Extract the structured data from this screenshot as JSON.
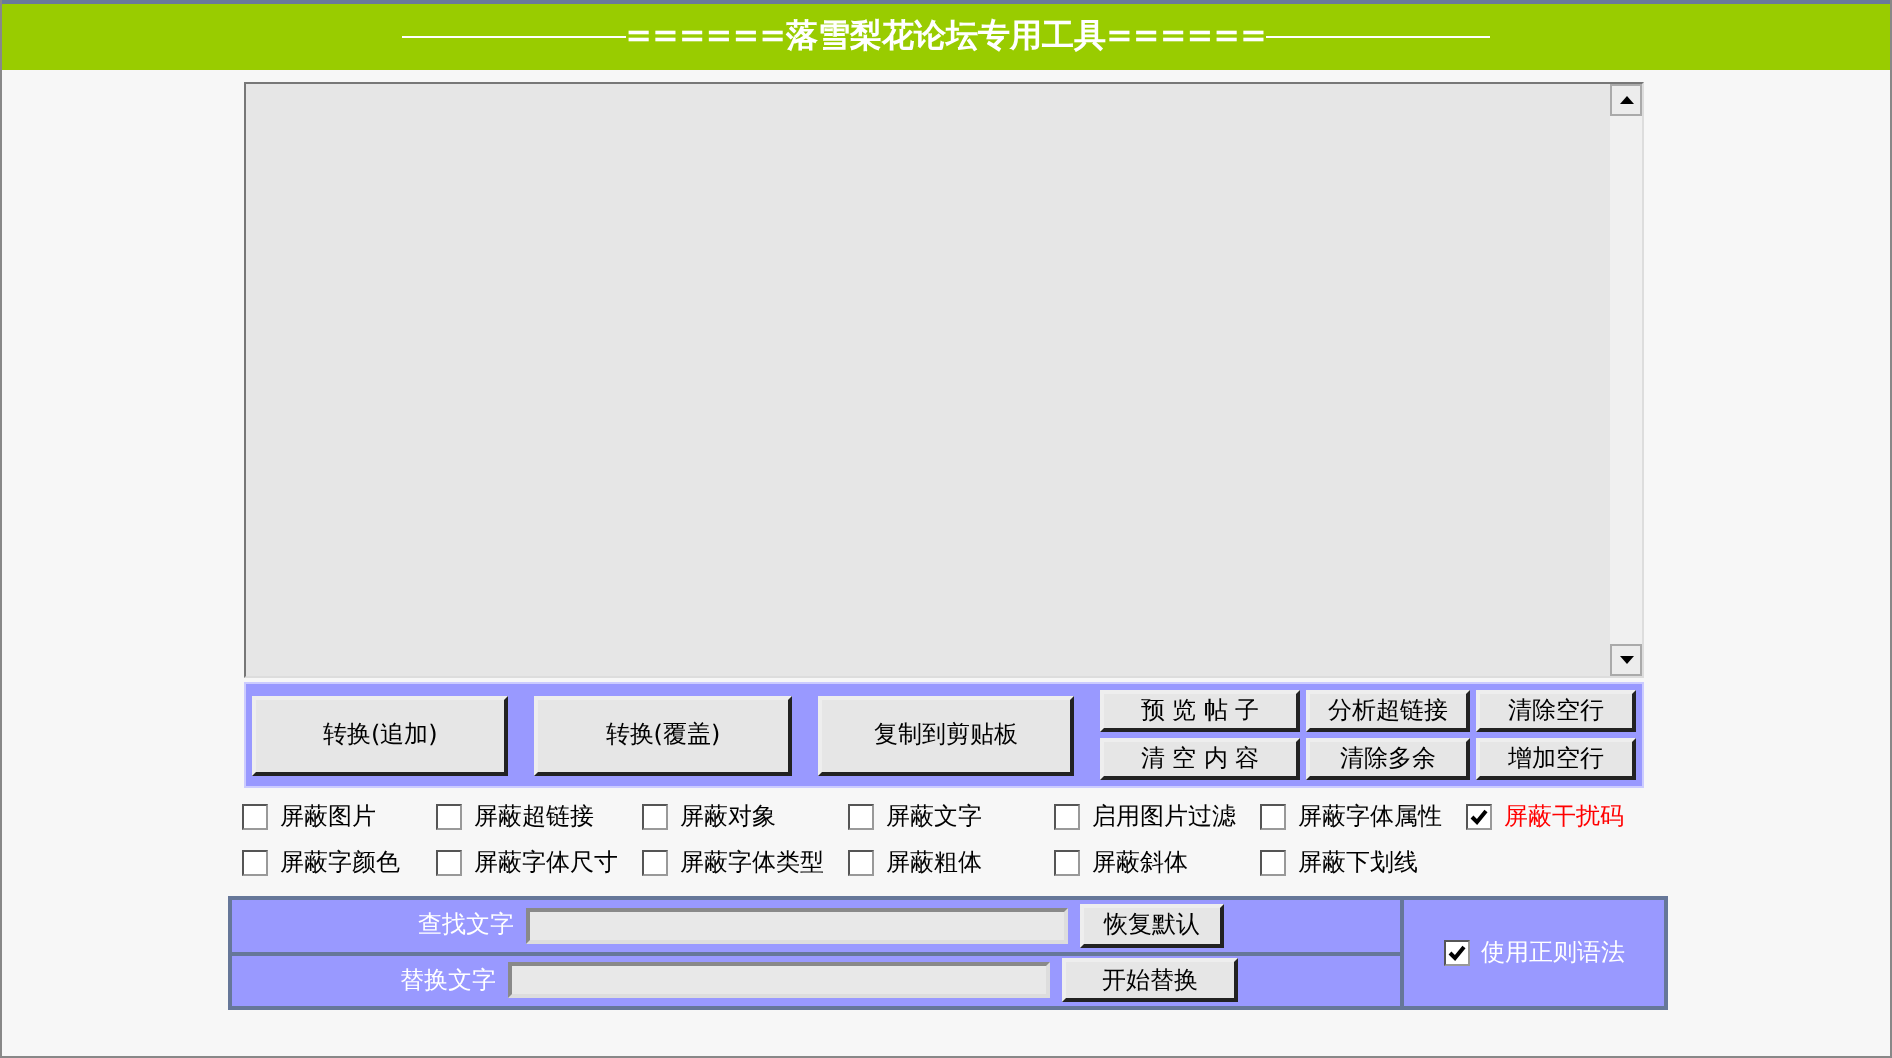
{
  "title": "======落雪梨花论坛专用工具======",
  "buttons_large": [
    "转换(追加)",
    "转换(覆盖)",
    "复制到剪贴板"
  ],
  "buttons_small": [
    "预 览 帖 子",
    "分析超链接",
    "清除空行",
    "清 空 内 容",
    "清除多余",
    "增加空行"
  ],
  "options": [
    {
      "label": "屏蔽图片",
      "checked": false,
      "color": "#000000"
    },
    {
      "label": "屏蔽超链接",
      "checked": false,
      "color": "#000000"
    },
    {
      "label": "屏蔽对象",
      "checked": false,
      "color": "#000000"
    },
    {
      "label": "屏蔽文字",
      "checked": false,
      "color": "#000000"
    },
    {
      "label": "启用图片过滤",
      "checked": false,
      "color": "#000000"
    },
    {
      "label": "屏蔽字体属性",
      "checked": false,
      "color": "#000000"
    },
    {
      "label": "屏蔽干扰码",
      "checked": true,
      "color": "#ff0000"
    },
    {
      "label": "屏蔽字颜色",
      "checked": false,
      "color": "#000000"
    },
    {
      "label": "屏蔽字体尺寸",
      "checked": false,
      "color": "#000000"
    },
    {
      "label": "屏蔽字体类型",
      "checked": false,
      "color": "#000000"
    },
    {
      "label": "屏蔽粗体",
      "checked": false,
      "color": "#000000"
    },
    {
      "label": "屏蔽斜体",
      "checked": false,
      "color": "#000000"
    },
    {
      "label": "屏蔽下划线",
      "checked": false,
      "color": "#000000"
    }
  ],
  "find": {
    "label": "查找文字",
    "button": "恢复默认"
  },
  "replace": {
    "label": "替换文字",
    "button": "开始替换"
  },
  "regex": {
    "label": "使用正则语法",
    "checked": true
  }
}
